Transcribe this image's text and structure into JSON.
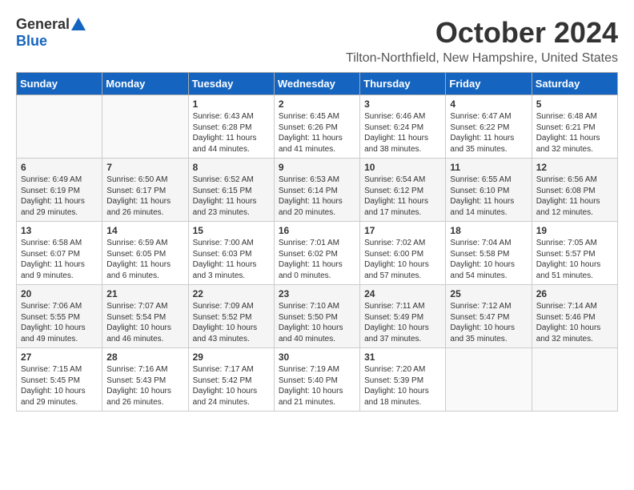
{
  "header": {
    "logo_general": "General",
    "logo_blue": "Blue",
    "month_title": "October 2024",
    "location": "Tilton-Northfield, New Hampshire, United States"
  },
  "days_of_week": [
    "Sunday",
    "Monday",
    "Tuesday",
    "Wednesday",
    "Thursday",
    "Friday",
    "Saturday"
  ],
  "weeks": [
    [
      {
        "day": "",
        "info": ""
      },
      {
        "day": "",
        "info": ""
      },
      {
        "day": "1",
        "info": "Sunrise: 6:43 AM\nSunset: 6:28 PM\nDaylight: 11 hours and 44 minutes."
      },
      {
        "day": "2",
        "info": "Sunrise: 6:45 AM\nSunset: 6:26 PM\nDaylight: 11 hours and 41 minutes."
      },
      {
        "day": "3",
        "info": "Sunrise: 6:46 AM\nSunset: 6:24 PM\nDaylight: 11 hours and 38 minutes."
      },
      {
        "day": "4",
        "info": "Sunrise: 6:47 AM\nSunset: 6:22 PM\nDaylight: 11 hours and 35 minutes."
      },
      {
        "day": "5",
        "info": "Sunrise: 6:48 AM\nSunset: 6:21 PM\nDaylight: 11 hours and 32 minutes."
      }
    ],
    [
      {
        "day": "6",
        "info": "Sunrise: 6:49 AM\nSunset: 6:19 PM\nDaylight: 11 hours and 29 minutes."
      },
      {
        "day": "7",
        "info": "Sunrise: 6:50 AM\nSunset: 6:17 PM\nDaylight: 11 hours and 26 minutes."
      },
      {
        "day": "8",
        "info": "Sunrise: 6:52 AM\nSunset: 6:15 PM\nDaylight: 11 hours and 23 minutes."
      },
      {
        "day": "9",
        "info": "Sunrise: 6:53 AM\nSunset: 6:14 PM\nDaylight: 11 hours and 20 minutes."
      },
      {
        "day": "10",
        "info": "Sunrise: 6:54 AM\nSunset: 6:12 PM\nDaylight: 11 hours and 17 minutes."
      },
      {
        "day": "11",
        "info": "Sunrise: 6:55 AM\nSunset: 6:10 PM\nDaylight: 11 hours and 14 minutes."
      },
      {
        "day": "12",
        "info": "Sunrise: 6:56 AM\nSunset: 6:08 PM\nDaylight: 11 hours and 12 minutes."
      }
    ],
    [
      {
        "day": "13",
        "info": "Sunrise: 6:58 AM\nSunset: 6:07 PM\nDaylight: 11 hours and 9 minutes."
      },
      {
        "day": "14",
        "info": "Sunrise: 6:59 AM\nSunset: 6:05 PM\nDaylight: 11 hours and 6 minutes."
      },
      {
        "day": "15",
        "info": "Sunrise: 7:00 AM\nSunset: 6:03 PM\nDaylight: 11 hours and 3 minutes."
      },
      {
        "day": "16",
        "info": "Sunrise: 7:01 AM\nSunset: 6:02 PM\nDaylight: 11 hours and 0 minutes."
      },
      {
        "day": "17",
        "info": "Sunrise: 7:02 AM\nSunset: 6:00 PM\nDaylight: 10 hours and 57 minutes."
      },
      {
        "day": "18",
        "info": "Sunrise: 7:04 AM\nSunset: 5:58 PM\nDaylight: 10 hours and 54 minutes."
      },
      {
        "day": "19",
        "info": "Sunrise: 7:05 AM\nSunset: 5:57 PM\nDaylight: 10 hours and 51 minutes."
      }
    ],
    [
      {
        "day": "20",
        "info": "Sunrise: 7:06 AM\nSunset: 5:55 PM\nDaylight: 10 hours and 49 minutes."
      },
      {
        "day": "21",
        "info": "Sunrise: 7:07 AM\nSunset: 5:54 PM\nDaylight: 10 hours and 46 minutes."
      },
      {
        "day": "22",
        "info": "Sunrise: 7:09 AM\nSunset: 5:52 PM\nDaylight: 10 hours and 43 minutes."
      },
      {
        "day": "23",
        "info": "Sunrise: 7:10 AM\nSunset: 5:50 PM\nDaylight: 10 hours and 40 minutes."
      },
      {
        "day": "24",
        "info": "Sunrise: 7:11 AM\nSunset: 5:49 PM\nDaylight: 10 hours and 37 minutes."
      },
      {
        "day": "25",
        "info": "Sunrise: 7:12 AM\nSunset: 5:47 PM\nDaylight: 10 hours and 35 minutes."
      },
      {
        "day": "26",
        "info": "Sunrise: 7:14 AM\nSunset: 5:46 PM\nDaylight: 10 hours and 32 minutes."
      }
    ],
    [
      {
        "day": "27",
        "info": "Sunrise: 7:15 AM\nSunset: 5:45 PM\nDaylight: 10 hours and 29 minutes."
      },
      {
        "day": "28",
        "info": "Sunrise: 7:16 AM\nSunset: 5:43 PM\nDaylight: 10 hours and 26 minutes."
      },
      {
        "day": "29",
        "info": "Sunrise: 7:17 AM\nSunset: 5:42 PM\nDaylight: 10 hours and 24 minutes."
      },
      {
        "day": "30",
        "info": "Sunrise: 7:19 AM\nSunset: 5:40 PM\nDaylight: 10 hours and 21 minutes."
      },
      {
        "day": "31",
        "info": "Sunrise: 7:20 AM\nSunset: 5:39 PM\nDaylight: 10 hours and 18 minutes."
      },
      {
        "day": "",
        "info": ""
      },
      {
        "day": "",
        "info": ""
      }
    ]
  ]
}
